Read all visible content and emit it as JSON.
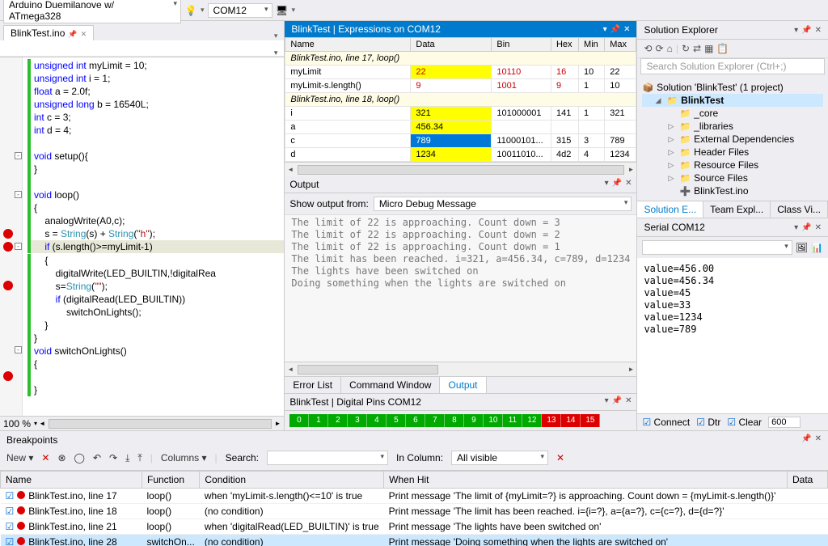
{
  "toolbar": {
    "board": "Arduino Duemilanove w/ ATmega328",
    "port": "COM12"
  },
  "editor": {
    "tab": "BlinkTest.ino",
    "zoom": "100 %",
    "code_lines": [
      {
        "html": "<span class='kw'>unsigned int</span> myLimit = 10;"
      },
      {
        "html": "<span class='kw'>unsigned int</span> i = 1;"
      },
      {
        "html": "<span class='kw'>float</span> a = 2.0f;"
      },
      {
        "html": "<span class='kw'>unsigned long</span> b = 16540L;"
      },
      {
        "html": "<span class='kw'>int</span> c = 3;"
      },
      {
        "html": "<span class='kw'>int</span> d = 4;"
      },
      {
        "html": ""
      },
      {
        "html": "<span class='kw'>void</span> setup(){",
        "fold": "-"
      },
      {
        "html": "}"
      },
      {
        "html": ""
      },
      {
        "html": "<span class='kw'>void</span> loop()",
        "fold": "-"
      },
      {
        "html": "{"
      },
      {
        "html": "    analogWrite(A0,c);"
      },
      {
        "html": "    s = <span class='typ'>String</span>(s) + <span class='typ'>String</span>(<span class='str'>\"h\"</span>);",
        "bp": true
      },
      {
        "html": "    <span class='kw'>if</span> (s.length()>=myLimit-1)",
        "fold": "-",
        "bp": true,
        "hl": true
      },
      {
        "html": "    {"
      },
      {
        "html": "        digitalWrite(LED_BUILTIN,!digitalRea"
      },
      {
        "html": "        s=<span class='typ'>String</span>(<span class='str'>\"\"</span>);",
        "bp": true
      },
      {
        "html": "        <span class='kw'>if</span> (digitalRead(LED_BUILTIN))"
      },
      {
        "html": "            switchOnLights();"
      },
      {
        "html": "    }"
      },
      {
        "html": "}"
      },
      {
        "html": "<span class='kw'>void</span> switchOnLights()",
        "fold": "-"
      },
      {
        "html": "{"
      },
      {
        "html": "",
        "bp": true
      },
      {
        "html": "}"
      }
    ]
  },
  "expressions": {
    "title": "BlinkTest | Expressions on COM12",
    "cols": [
      "Name",
      "Data",
      "Bin",
      "Hex",
      "Min",
      "Max"
    ],
    "groups": [
      {
        "label": "BlinkTest.ino, line 17, loop()",
        "rows": [
          {
            "name": "myLimit",
            "data": "22",
            "data_yel": true,
            "bin": "10110",
            "hex": "16",
            "min": "10",
            "max": "22",
            "red": true
          },
          {
            "name": "myLimit-s.length()",
            "data": "9",
            "bin": "1001",
            "hex": "9",
            "min": "1",
            "max": "10",
            "red": true
          }
        ]
      },
      {
        "label": "BlinkTest.ino, line 18, loop()",
        "rows": [
          {
            "name": "i",
            "data": "321",
            "data_yel": true,
            "bin": "101000001",
            "hex": "141",
            "min": "1",
            "max": "321"
          },
          {
            "name": "a",
            "data": "456.34",
            "data_yel": true,
            "bin": "",
            "hex": "",
            "min": "",
            "max": ""
          },
          {
            "name": "c",
            "data": "789",
            "data_sel": true,
            "bin": "11000101...",
            "hex": "315",
            "min": "3",
            "max": "789"
          },
          {
            "name": "d",
            "data": "1234",
            "data_yel": true,
            "bin": "10011010...",
            "hex": "4d2",
            "min": "4",
            "max": "1234"
          }
        ]
      }
    ]
  },
  "output": {
    "title": "Output",
    "source_label": "Show output from:",
    "source": "Micro Debug Message",
    "lines": [
      "The limit of 22 is approaching. Count down = 3",
      "The limit of 22 is approaching. Count down = 2",
      "The limit of 22 is approaching. Count down = 1",
      "The limit has been reached. i=321, a=456.34, c=789, d=1234",
      "The lights have been switched on",
      "Doing something when the lights are switched on"
    ],
    "tabs": [
      "Error List",
      "Command Window",
      "Output"
    ],
    "active_tab": "Output"
  },
  "pins": {
    "title": "BlinkTest | Digital Pins COM12",
    "pins": [
      {
        "n": "0",
        "c": "g"
      },
      {
        "n": "1",
        "c": "g"
      },
      {
        "n": "2",
        "c": "g"
      },
      {
        "n": "3",
        "c": "g"
      },
      {
        "n": "4",
        "c": "g"
      },
      {
        "n": "5",
        "c": "g"
      },
      {
        "n": "6",
        "c": "g"
      },
      {
        "n": "7",
        "c": "g"
      },
      {
        "n": "8",
        "c": "g"
      },
      {
        "n": "9",
        "c": "g"
      },
      {
        "n": "10",
        "c": "g"
      },
      {
        "n": "11",
        "c": "g"
      },
      {
        "n": "12",
        "c": "g"
      },
      {
        "n": "13",
        "c": "r"
      },
      {
        "n": "14",
        "c": "r"
      },
      {
        "n": "15",
        "c": "r"
      }
    ]
  },
  "solution": {
    "title": "Solution Explorer",
    "search_placeholder": "Search Solution Explorer (Ctrl+;)",
    "root": "Solution 'BlinkTest' (1 project)",
    "project": "BlinkTest",
    "items": [
      "_core",
      "_libraries",
      "External Dependencies",
      "Header Files",
      "Resource Files",
      "Source Files",
      "BlinkTest.ino"
    ],
    "tabs": [
      "Solution E...",
      "Team Expl...",
      "Class Vi..."
    ]
  },
  "serial": {
    "title": "Serial COM12",
    "lines": [
      "value=456.00",
      "value=456.34",
      "value=45",
      "value=33",
      "value=1234",
      "value=789"
    ],
    "opts": [
      "Connect",
      "Dtr",
      "Clear"
    ],
    "baud": "600"
  },
  "breakpoints": {
    "title": "Breakpoints",
    "toolbar": {
      "new": "New",
      "columns": "Columns",
      "search": "Search:",
      "incol": "In Column:",
      "incol_val": "All visible"
    },
    "cols": [
      "Name",
      "Function",
      "Condition",
      "When Hit",
      "Data"
    ],
    "rows": [
      {
        "name": "BlinkTest.ino, line 17",
        "func": "loop()",
        "cond": "when 'myLimit-s.length()<=10' is true",
        "hit": "Print message 'The limit of {myLimit=?} is approaching. Count down = {myLimit-s.length()}'"
      },
      {
        "name": "BlinkTest.ino, line 18",
        "func": "loop()",
        "cond": "(no condition)",
        "hit": "Print message 'The limit has been reached. i={i=?}, a={a=?}, c={c=?}, d={d=?}'"
      },
      {
        "name": "BlinkTest.ino, line 21",
        "func": "loop()",
        "cond": "when 'digitalRead(LED_BUILTIN)' is true",
        "hit": "Print message 'The lights have been switched on'"
      },
      {
        "name": "BlinkTest.ino, line 28",
        "func": "switchOn...",
        "cond": "(no condition)",
        "hit": "Print message 'Doing something when the lights are switched on'",
        "sel": true
      }
    ]
  }
}
